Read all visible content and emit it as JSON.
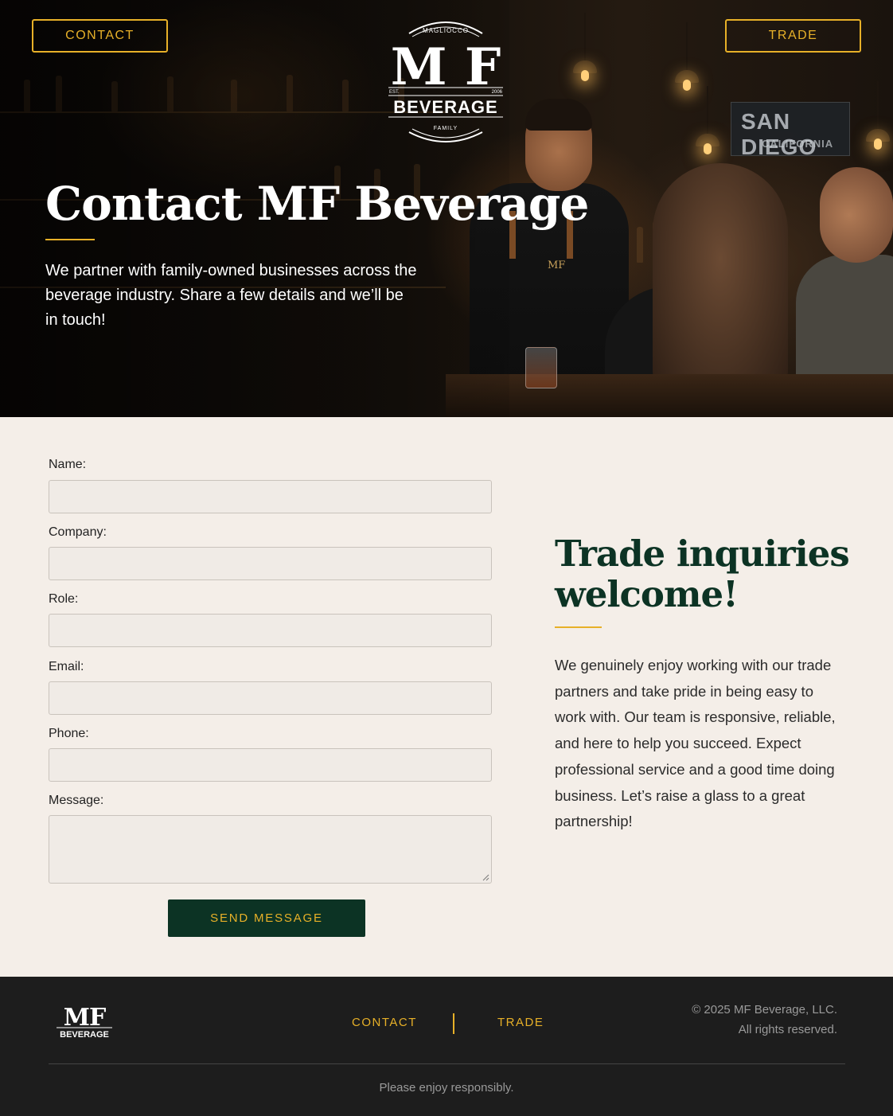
{
  "header": {
    "contact_label": "CONTACT",
    "trade_label": "TRADE",
    "logo": {
      "top_text": "MAGLIOCCO",
      "monogram": "M F",
      "est": "EST.",
      "year": "2006",
      "wordmark": "BEVERAGE",
      "bottom_text": "FAMILY"
    }
  },
  "hero": {
    "title": "Contact MF Beverage",
    "subtitle": "We partner with family-owned businesses across the beverage industry. Share a few details and we’ll be in touch!",
    "sign_main": "SAN DIEGO",
    "sign_sub": "CALIFORNIA",
    "apron_badge": "MF"
  },
  "form": {
    "fields": [
      {
        "label": "Name:",
        "value": ""
      },
      {
        "label": "Company:",
        "value": ""
      },
      {
        "label": "Role:",
        "value": ""
      },
      {
        "label": "Email:",
        "value": ""
      },
      {
        "label": "Phone:",
        "value": ""
      },
      {
        "label": "Message:",
        "value": ""
      }
    ],
    "submit_label": "SEND MESSAGE"
  },
  "trade": {
    "title": "Trade inquiries welcome!",
    "body": "We genuinely enjoy working with our trade partners and take pride in being easy to work with. Our team is responsive, reliable, and here to help you succeed. Expect professional service and a good time doing business. Let’s raise a glass to a great partnership!"
  },
  "footer": {
    "logo_monogram": "MF",
    "logo_wordmark": "BEVERAGE",
    "links": [
      "CONTACT",
      "TRADE"
    ],
    "copyright_line1": "© 2025 MF Beverage, LLC.",
    "copyright_line2": "All rights reserved.",
    "note": "Please enjoy responsibly."
  },
  "colors": {
    "accent_gold": "#e7b028",
    "brand_green": "#0c3324",
    "page_bg": "#f4eee8",
    "footer_bg": "#1d1d1d"
  }
}
